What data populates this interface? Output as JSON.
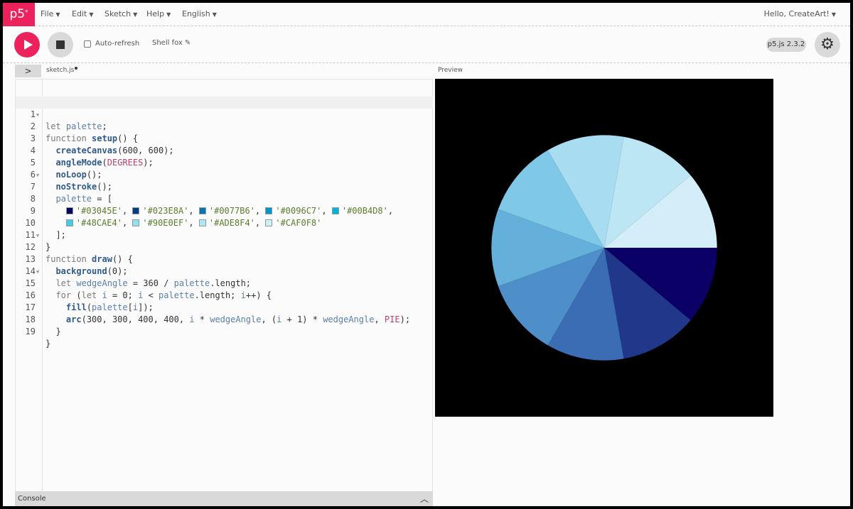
{
  "nav": {
    "logo": "p5",
    "logo_mark": "*",
    "menus": [
      "File",
      "Edit",
      "Sketch",
      "Help",
      "English"
    ],
    "user_greeting": "Hello, CreateArt!"
  },
  "toolbar": {
    "play_label": "Play",
    "stop_label": "Stop",
    "auto_refresh_label": "Auto-refresh",
    "auto_refresh_checked": false,
    "sketch_name": "Shell fox",
    "version": "p5.js 2.3.2"
  },
  "editor": {
    "filename": "sketch.js",
    "unsaved": true,
    "line_numbers": [
      "1",
      "2",
      "3",
      "4",
      "5",
      "6",
      "7",
      "8",
      "9",
      "10",
      "11",
      "12",
      "13",
      "14",
      "15",
      "16",
      "17",
      "18",
      "19"
    ],
    "palette_swatches": [
      "#03045E",
      "#023E8A",
      "#0077B6",
      "#0096C7",
      "#00B4D8",
      "#48CAE4",
      "#90E0EF",
      "#ADE8F4",
      "#CAF0F8"
    ],
    "palette_strings": [
      "'#03045E'",
      "'#023E8A'",
      "'#0077B6'",
      "'#0096C7'",
      "'#00B4D8'",
      "'#48CAE4'",
      "'#90E0EF'",
      "'#ADE8F4'",
      "'#CAF0F8'"
    ]
  },
  "preview": {
    "label": "Preview",
    "wedge_colors": [
      "#0b0066",
      "#21388a",
      "#3b6db4",
      "#4e8ec9",
      "#64b0da",
      "#80c8e8",
      "#a8dcf0",
      "#bde6f4",
      "#d3eef8"
    ]
  },
  "console": {
    "label": "Console"
  }
}
